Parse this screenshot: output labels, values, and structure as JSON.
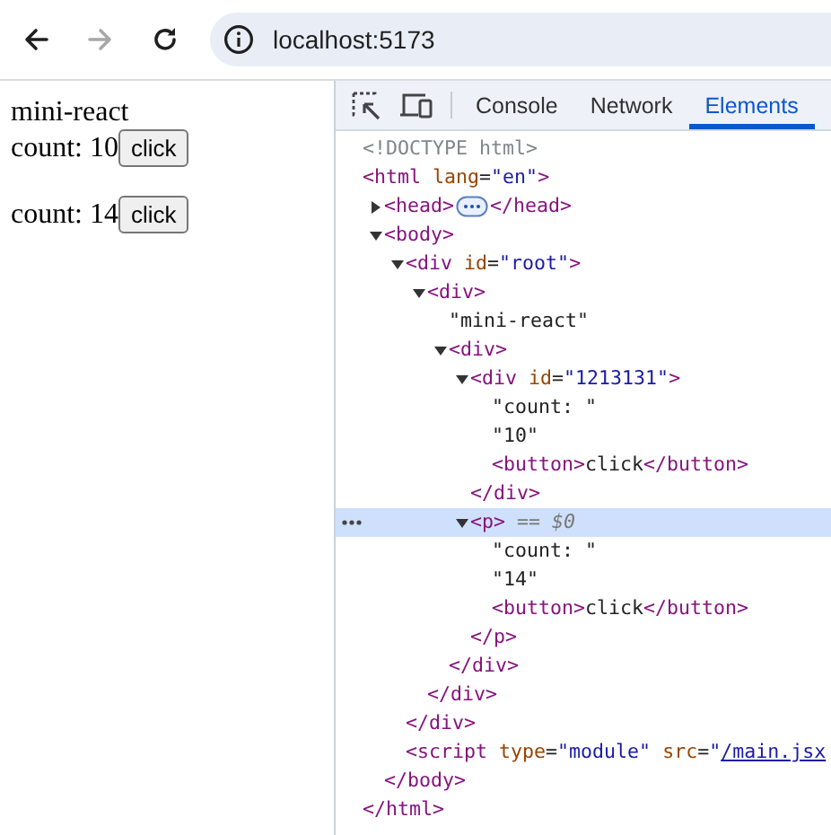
{
  "browser": {
    "nav_buttons": [
      {
        "kind": "back",
        "disabled": false
      },
      {
        "kind": "forward",
        "disabled": true
      },
      {
        "kind": "reload",
        "disabled": false
      }
    ],
    "address": "localhost:5173"
  },
  "page": {
    "heading": "mini-react",
    "counters": [
      {
        "label": "count: ",
        "value": "10",
        "button": "click"
      },
      {
        "label": "count: ",
        "value": "14",
        "button": "click"
      }
    ]
  },
  "devtools": {
    "tabs": [
      {
        "label": "Console",
        "selected": false
      },
      {
        "label": "Network",
        "selected": false
      },
      {
        "label": "Elements",
        "selected": true
      }
    ],
    "dom_tree": [
      {
        "selected": false,
        "open": [
          {
            "kind": "doctype",
            "text": "<!DOCTYPE html>"
          }
        ]
      },
      {
        "selected": false,
        "open": [
          {
            "kind": "tag",
            "text": "<html "
          },
          {
            "kind": "attr",
            "text": "lang"
          },
          {
            "kind": "text",
            "text": "="
          },
          {
            "kind": "value",
            "text": "\"en\""
          },
          {
            "kind": "tag",
            "text": ">"
          }
        ],
        "close": [
          {
            "kind": "tag",
            "text": "</html>"
          }
        ],
        "children": [
          {
            "selected": false,
            "expanded": false,
            "open": [
              {
                "kind": "tag",
                "text": "<head>"
              }
            ],
            "close": [
              {
                "kind": "tag",
                "text": "</head>"
              }
            ]
          },
          {
            "selected": false,
            "expanded": true,
            "open": [
              {
                "kind": "tag",
                "text": "<body>"
              }
            ],
            "close": [
              {
                "kind": "tag",
                "text": "</body>"
              }
            ],
            "children": [
              {
                "selected": false,
                "expanded": true,
                "open": [
                  {
                    "kind": "tag",
                    "text": "<div "
                  },
                  {
                    "kind": "attr",
                    "text": "id"
                  },
                  {
                    "kind": "text",
                    "text": "="
                  },
                  {
                    "kind": "value",
                    "text": "\"root\""
                  },
                  {
                    "kind": "tag",
                    "text": ">"
                  }
                ],
                "close": [
                  {
                    "kind": "tag",
                    "text": "</div>"
                  }
                ],
                "children": [
                  {
                    "selected": false,
                    "expanded": true,
                    "open": [
                      {
                        "kind": "tag",
                        "text": "<div>"
                      }
                    ],
                    "close": [
                      {
                        "kind": "tag",
                        "text": "</div>"
                      }
                    ],
                    "children": [
                      {
                        "selected": false,
                        "open": [
                          {
                            "kind": "text",
                            "text": "\"mini-react\""
                          }
                        ]
                      },
                      {
                        "selected": false,
                        "expanded": true,
                        "open": [
                          {
                            "kind": "tag",
                            "text": "<div>"
                          }
                        ],
                        "close": [
                          {
                            "kind": "tag",
                            "text": "</div>"
                          }
                        ],
                        "children": [
                          {
                            "selected": false,
                            "expanded": true,
                            "open": [
                              {
                                "kind": "tag",
                                "text": "<div "
                              },
                              {
                                "kind": "attr",
                                "text": "id"
                              },
                              {
                                "kind": "text",
                                "text": "="
                              },
                              {
                                "kind": "value",
                                "text": "\"1213131\""
                              },
                              {
                                "kind": "tag",
                                "text": ">"
                              }
                            ],
                            "close": [
                              {
                                "kind": "tag",
                                "text": "</div>"
                              }
                            ],
                            "children": [
                              {
                                "selected": false,
                                "open": [
                                  {
                                    "kind": "text",
                                    "text": "\"count: \""
                                  }
                                ]
                              },
                              {
                                "selected": false,
                                "open": [
                                  {
                                    "kind": "text",
                                    "text": "\"10\""
                                  }
                                ]
                              },
                              {
                                "selected": false,
                                "open": [
                                  {
                                    "kind": "tag",
                                    "text": "<button>"
                                  },
                                  {
                                    "kind": "text",
                                    "text": "click"
                                  },
                                  {
                                    "kind": "tag",
                                    "text": "</button>"
                                  }
                                ]
                              }
                            ]
                          },
                          {
                            "selected": true,
                            "expanded": true,
                            "open": [
                              {
                                "kind": "tag",
                                "text": "<p>"
                              },
                              {
                                "kind": "ref",
                                "text": " == $0"
                              }
                            ],
                            "close": [
                              {
                                "kind": "tag",
                                "text": "</p>"
                              }
                            ],
                            "children": [
                              {
                                "selected": false,
                                "open": [
                                  {
                                    "kind": "text",
                                    "text": "\"count: \""
                                  }
                                ]
                              },
                              {
                                "selected": false,
                                "open": [
                                  {
                                    "kind": "text",
                                    "text": "\"14\""
                                  }
                                ]
                              },
                              {
                                "selected": false,
                                "open": [
                                  {
                                    "kind": "tag",
                                    "text": "<button>"
                                  },
                                  {
                                    "kind": "text",
                                    "text": "click"
                                  },
                                  {
                                    "kind": "tag",
                                    "text": "</button>"
                                  }
                                ]
                              }
                            ]
                          }
                        ]
                      }
                    ]
                  }
                ]
              },
              {
                "selected": false,
                "open": [
                  {
                    "kind": "tag",
                    "text": "<script "
                  },
                  {
                    "kind": "attr",
                    "text": "type"
                  },
                  {
                    "kind": "text",
                    "text": "="
                  },
                  {
                    "kind": "value",
                    "text": "\"module\""
                  },
                  {
                    "kind": "attr",
                    "text": " src"
                  },
                  {
                    "kind": "text",
                    "text": "="
                  },
                  {
                    "kind": "value",
                    "text": "\""
                  },
                  {
                    "kind": "link",
                    "text": "/main.jsx"
                  }
                ]
              }
            ]
          }
        ]
      }
    ]
  }
}
